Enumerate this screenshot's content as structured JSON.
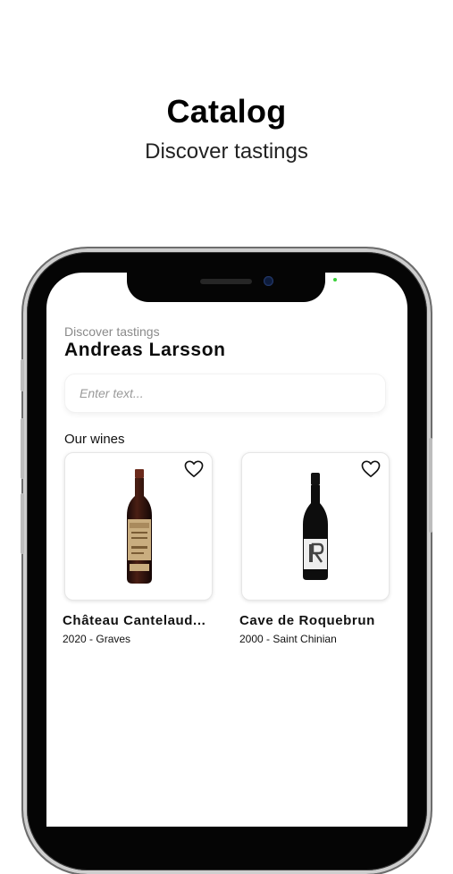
{
  "header": {
    "title": "Catalog",
    "subtitle": "Discover tastings"
  },
  "app": {
    "subtitle": "Discover tastings",
    "user_name": "Andreas Larsson",
    "search": {
      "placeholder": "Enter text...",
      "value": ""
    },
    "section_title": "Our wines",
    "wines": [
      {
        "name": "Château Cantelaud...",
        "meta": "2020 - Graves",
        "favorite": false,
        "icon": "heart-outline"
      },
      {
        "name": "Cave de Roquebrun",
        "meta": "2000 - Saint Chinian",
        "favorite": false,
        "icon": "heart-outline"
      }
    ]
  },
  "colors": {
    "accent_text": "#111111",
    "muted_text": "#8a8a8a",
    "camera_led": "#3ad13a"
  }
}
